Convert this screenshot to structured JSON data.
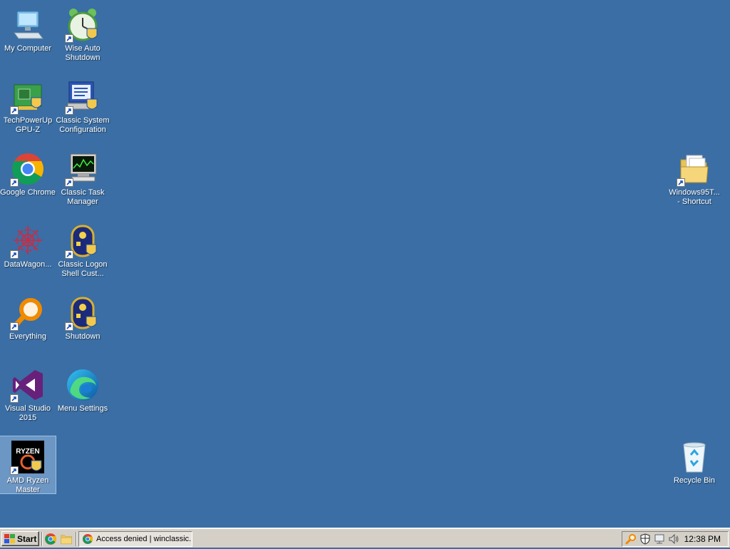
{
  "desktop": {
    "background_color": "#3a6ea5",
    "icons": {
      "my_computer": {
        "label": "My Computer",
        "icon": "computer-icon"
      },
      "wise_auto_shutdown": {
        "label": "Wise Auto Shutdown",
        "icon": "alarm-clock-icon"
      },
      "gpu_z": {
        "label": "TechPowerUp GPU-Z",
        "icon": "gpu-card-icon"
      },
      "classic_system_config": {
        "label": "Classic System Configuration",
        "icon": "system-config-icon"
      },
      "google_chrome": {
        "label": "Google Chrome",
        "icon": "chrome-icon"
      },
      "classic_task_manager": {
        "label": "Classic Task Manager",
        "icon": "task-manager-icon"
      },
      "datawagon": {
        "label": "DataWagon...",
        "icon": "datawagon-icon"
      },
      "classic_logon": {
        "label": "Classic Logon Shell Cust...",
        "icon": "logon-shell-icon"
      },
      "everything": {
        "label": "Everything",
        "icon": "magnifier-icon"
      },
      "shutdown": {
        "label": "Shutdown",
        "icon": "shutdown-icon"
      },
      "visual_studio": {
        "label": "Visual Studio 2015",
        "icon": "visual-studio-icon"
      },
      "menu_settings": {
        "label": "Menu Settings",
        "icon": "edge-icon"
      },
      "amd_ryzen_master": {
        "label": "AMD Ryzen Master",
        "icon": "ryzen-icon",
        "selected": true
      },
      "windows95_shortcut": {
        "label": "Windows95T... - Shortcut",
        "icon": "folder-icon"
      },
      "recycle_bin": {
        "label": "Recycle Bin",
        "icon": "recycle-bin-icon"
      }
    }
  },
  "taskbar": {
    "start_label": "Start",
    "quick_launch": [
      "chrome-icon",
      "folder-icon"
    ],
    "task_button_label": "Access denied | winclassic...",
    "tray_icons": [
      "magnifier-icon",
      "shield-icon",
      "network-icon",
      "volume-icon"
    ],
    "clock": "12:38 PM"
  }
}
